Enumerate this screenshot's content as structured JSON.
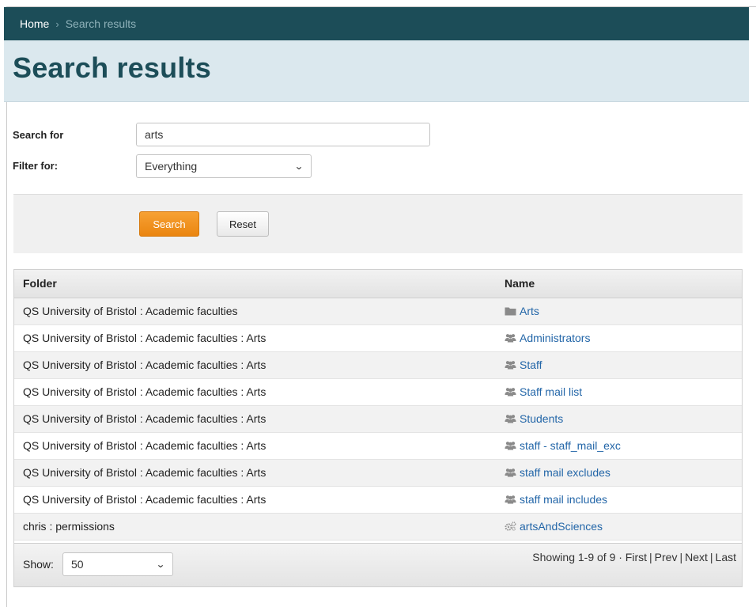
{
  "breadcrumb": {
    "home": "Home",
    "separator": "›",
    "current": "Search results"
  },
  "page": {
    "title": "Search results"
  },
  "form": {
    "search_label": "Search for",
    "search_value": "arts",
    "filter_label": "Filter for:",
    "filter_value": "Everything",
    "search_button": "Search",
    "reset_button": "Reset"
  },
  "table": {
    "columns": [
      "Folder",
      "Name"
    ],
    "rows": [
      {
        "folder": "QS University of Bristol : Academic faculties",
        "name": "Arts",
        "icon": "folder-icon"
      },
      {
        "folder": "QS University of Bristol : Academic faculties : Arts",
        "name": "Administrators",
        "icon": "group-icon"
      },
      {
        "folder": "QS University of Bristol : Academic faculties : Arts",
        "name": "Staff",
        "icon": "group-icon"
      },
      {
        "folder": "QS University of Bristol : Academic faculties : Arts",
        "name": "Staff mail list",
        "icon": "group-icon"
      },
      {
        "folder": "QS University of Bristol : Academic faculties : Arts",
        "name": "Students",
        "icon": "group-icon"
      },
      {
        "folder": "QS University of Bristol : Academic faculties : Arts",
        "name": "staff - staff_mail_exc",
        "icon": "group-icon"
      },
      {
        "folder": "QS University of Bristol : Academic faculties : Arts",
        "name": "staff mail excludes",
        "icon": "group-icon"
      },
      {
        "folder": "QS University of Bristol : Academic faculties : Arts",
        "name": "staff mail includes",
        "icon": "group-icon"
      },
      {
        "folder": "chris : permissions",
        "name": "artsAndSciences",
        "icon": "gears-icon"
      }
    ]
  },
  "footer": {
    "show_label": "Show:",
    "show_value": "50",
    "summary": "Showing 1-9 of 9 ·",
    "first": "First",
    "prev": "Prev",
    "next": "Next",
    "last": "Last",
    "pipe": "|"
  },
  "colors": {
    "brand": "#1c4d58",
    "accent": "#f39521",
    "link": "#2366a8",
    "header_bg": "#dbe8ee"
  }
}
